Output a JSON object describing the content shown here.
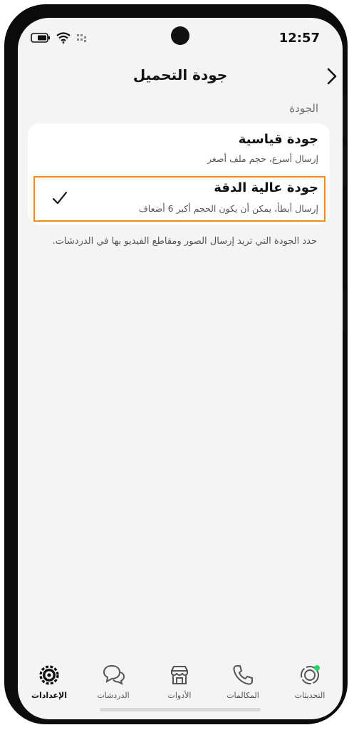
{
  "status_bar": {
    "time": "12:57"
  },
  "header": {
    "title": "جودة التحميل"
  },
  "section": {
    "label": "الجودة"
  },
  "options": [
    {
      "title": "جودة قياسية",
      "subtitle": "إرسال أسرع، حجم ملف أصغر",
      "selected": false
    },
    {
      "title": "جودة عالية الدقة",
      "subtitle": "إرسال أبطأ، يمكن أن يكون الحجم أكبر 6 أضعاف",
      "selected": true
    }
  ],
  "note": "حدد الجودة التي تريد إرسال الصور ومقاطع الفيديو بها في الدردشات.",
  "nav": {
    "settings": "الإعدادات",
    "chats": "الدردشات",
    "tools": "الأدوات",
    "calls": "المكالمات",
    "updates": "التحديثات"
  },
  "colors": {
    "highlight": "#f08b1f",
    "update_dot": "#25d366"
  }
}
